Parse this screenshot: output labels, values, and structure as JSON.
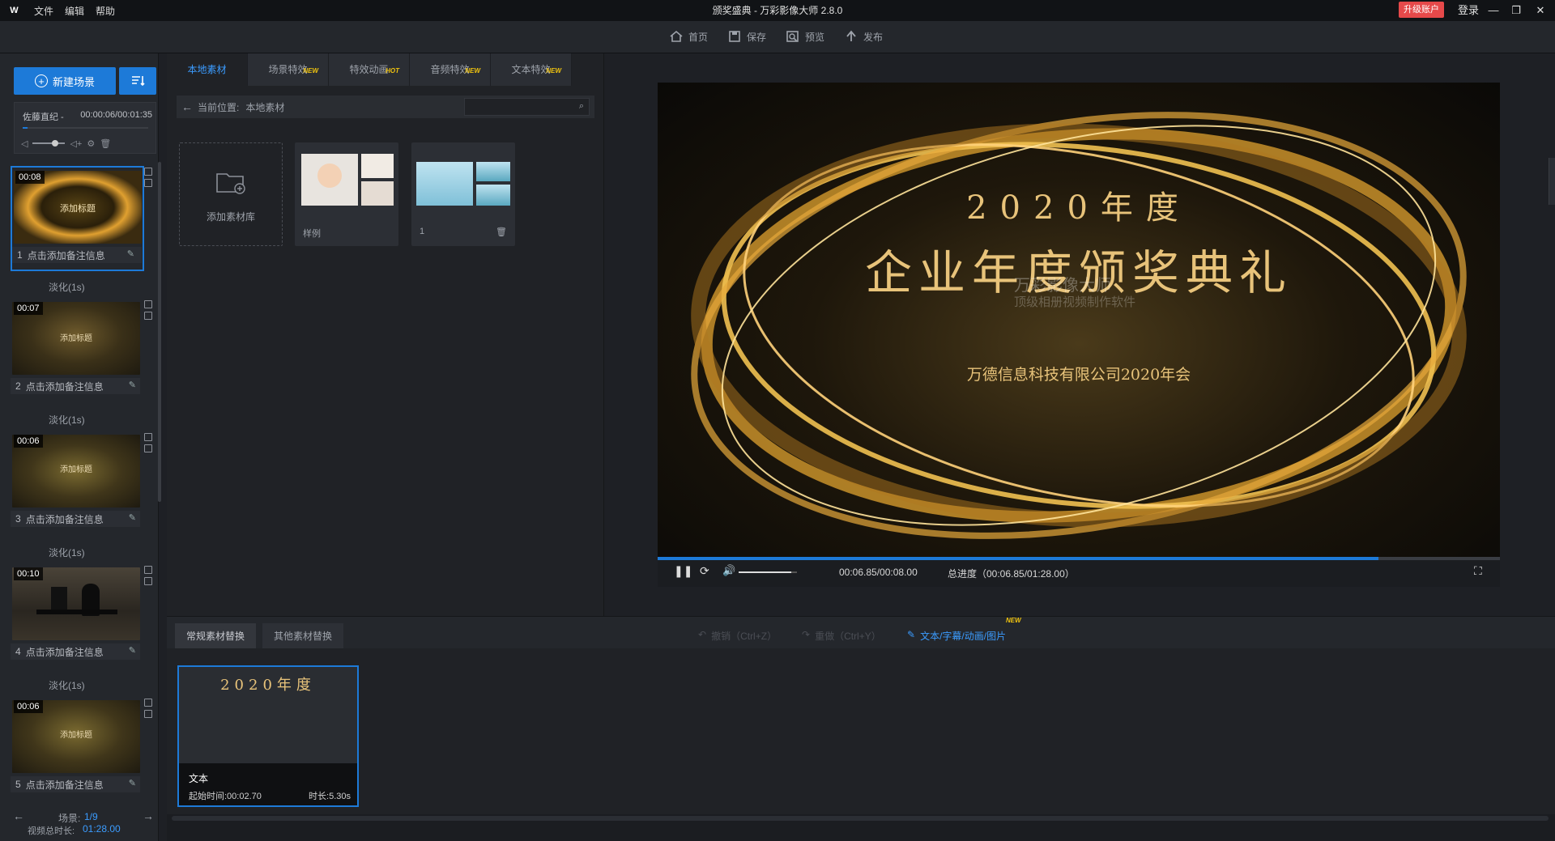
{
  "app": {
    "title": "颁奖盛典 - 万彩影像大师 2.8.0",
    "logo": "W",
    "menu": [
      "文件",
      "编辑",
      "帮助"
    ],
    "upgrade": "升级账户",
    "login": "登录"
  },
  "toolbar": {
    "home": "首页",
    "save": "保存",
    "preview": "预览",
    "publish": "发布"
  },
  "left": {
    "new_scene": "新建场景",
    "music": {
      "name": "佐藤直纪 -",
      "time": "00:00:06/00:01:35"
    },
    "scenes": [
      {
        "num": "1",
        "dur": "00:08",
        "caption": "点击添加备注信息",
        "label": "添加标题"
      },
      {
        "num": "2",
        "dur": "00:07",
        "caption": "点击添加备注信息",
        "label": "添加标题"
      },
      {
        "num": "3",
        "dur": "00:06",
        "caption": "点击添加备注信息",
        "label": "添加标题"
      },
      {
        "num": "4",
        "dur": "00:10",
        "caption": "点击添加备注信息",
        "label": ""
      },
      {
        "num": "5",
        "dur": "00:06",
        "caption": "点击添加备注信息",
        "label": "添加标题"
      }
    ],
    "transition": "淡化(1s)",
    "scene_label": "场景:",
    "scene_index": "1/9",
    "total_label": "视频总时长:",
    "total": "01:28.00"
  },
  "mid": {
    "tabs": [
      {
        "label": "本地素材",
        "badge": ""
      },
      {
        "label": "场景特效",
        "badge": "NEW"
      },
      {
        "label": "特效动画",
        "badge": "HOT"
      },
      {
        "label": "音频特效",
        "badge": "NEW"
      },
      {
        "label": "文本特效",
        "badge": "NEW"
      }
    ],
    "location_label": "当前位置:",
    "location": "本地素材",
    "add_library": "添加素材库",
    "sample": "样例",
    "folder1": "1"
  },
  "preview": {
    "year": "2020年度",
    "title": "企业年度颁奖典礼",
    "subtitle": "万德信息科技有限公司2020年会",
    "watermark1": "万彩影像大师",
    "watermark2": "顶级相册视频制作软件",
    "time": "00:06.85/00:08.00",
    "total": "总进度（00:06.85/01:28.00）",
    "progress": 0.856,
    "volume": 0.9
  },
  "bottom": {
    "tab1": "常规素材替换",
    "tab2": "其他素材替换",
    "undo": "撤销（Ctrl+Z）",
    "redo": "重做（Ctrl+Y）",
    "edit": "文本/字幕/动画/图片",
    "edit_badge": "NEW",
    "card": {
      "preview": "2020年度",
      "type": "文本",
      "start": "起始时间:00:02.70",
      "dur": "时长:5.30s"
    }
  },
  "colors": {
    "accent": "#1d7ad8",
    "gold": "#e8c37a",
    "upgrade": "#e6494a"
  }
}
